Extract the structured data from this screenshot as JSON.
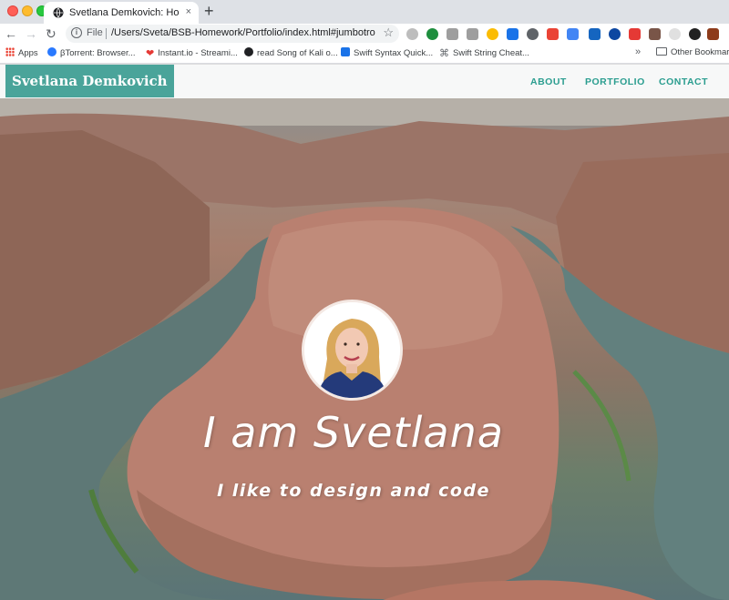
{
  "browser": {
    "tab_title": "Svetlana Demkovich: Home Page",
    "tab_close": "×",
    "new_tab": "+",
    "scheme_label": "File",
    "url": "/Users/Sveta/BSB-Homework/Portfolio/index.html#jumbotron-s...",
    "info_glyph": "i",
    "star_glyph": "☆",
    "back_glyph": "←",
    "forward_glyph": "→",
    "reload_glyph": "↻"
  },
  "bookmarks": {
    "items": [
      {
        "label": "Apps",
        "icon": "apps-grid-icon"
      },
      {
        "label": "βTorrent: Browser...",
        "icon": "btorrent-icon",
        "color": "#2979ff"
      },
      {
        "label": "Instant.io - Streami...",
        "icon": "heart-icon",
        "color": "#e53935"
      },
      {
        "label": "read Song of Kali o...",
        "icon": "globe-icon",
        "color": "#202124"
      },
      {
        "label": "Swift Syntax Quick...",
        "icon": "swift-icon",
        "color": "#1a73e8"
      },
      {
        "label": "Swift String Cheat...",
        "icon": "command-icon",
        "color": "#5f6368"
      }
    ],
    "more_glyph": "»",
    "other_label": "Other Bookmarks"
  },
  "site": {
    "brand": "Svetlana Demkovich",
    "nav": [
      "ABOUT",
      "PORTFOLIO",
      "CONTACT"
    ],
    "accent": "#2a9d8f",
    "brand_bg": "#4aa49a"
  },
  "hero": {
    "headline": "I am Svetlana",
    "subline": "I like to design and code"
  }
}
